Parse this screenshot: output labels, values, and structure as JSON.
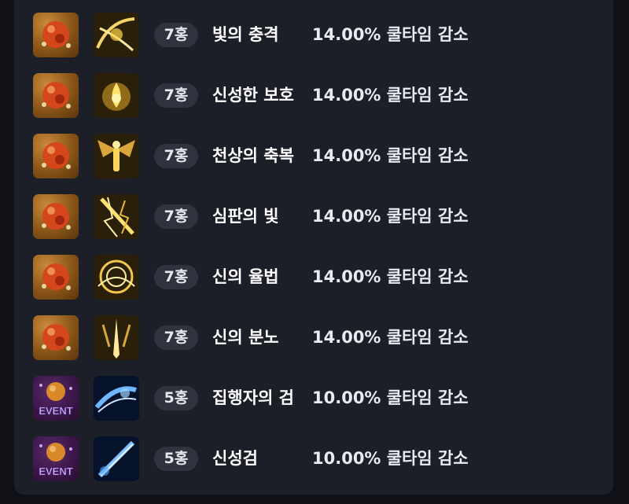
{
  "colors": {
    "background": "#0f1117",
    "panel": "#1c1f27",
    "badge_bg": "#2f333d",
    "text": "#ffffff"
  },
  "items": [
    {
      "gem_icon": "red-gem-icon",
      "skill_icon": "light-impact-skill-icon",
      "tier": "7홍",
      "skill_name": "빛의 충격",
      "effect": "14.00% 쿨타임 감소"
    },
    {
      "gem_icon": "red-gem-icon",
      "skill_icon": "divine-protection-skill-icon",
      "tier": "7홍",
      "skill_name": "신성한 보호",
      "effect": "14.00% 쿨타임 감소"
    },
    {
      "gem_icon": "red-gem-icon",
      "skill_icon": "heavenly-blessing-skill-icon",
      "tier": "7홍",
      "skill_name": "천상의 축복",
      "effect": "14.00% 쿨타임 감소"
    },
    {
      "gem_icon": "red-gem-icon",
      "skill_icon": "light-of-judgment-skill-icon",
      "tier": "7홍",
      "skill_name": "심판의 빛",
      "effect": "14.00% 쿨타임 감소"
    },
    {
      "gem_icon": "red-gem-icon",
      "skill_icon": "divine-law-skill-icon",
      "tier": "7홍",
      "skill_name": "신의 율법",
      "effect": "14.00% 쿨타임 감소"
    },
    {
      "gem_icon": "red-gem-icon",
      "skill_icon": "divine-wrath-skill-icon",
      "tier": "7홍",
      "skill_name": "신의 분노",
      "effect": "14.00% 쿨타임 감소"
    },
    {
      "gem_icon": "event-gem-icon",
      "gem_label": "EVENT",
      "skill_icon": "executioner-sword-skill-icon",
      "tier": "5홍",
      "skill_name": "집행자의 검",
      "effect": "10.00% 쿨타임 감소"
    },
    {
      "gem_icon": "event-gem-icon",
      "gem_label": "EVENT",
      "skill_icon": "holy-sword-skill-icon",
      "tier": "5홍",
      "skill_name": "신성검",
      "effect": "10.00% 쿨타임 감소"
    }
  ]
}
